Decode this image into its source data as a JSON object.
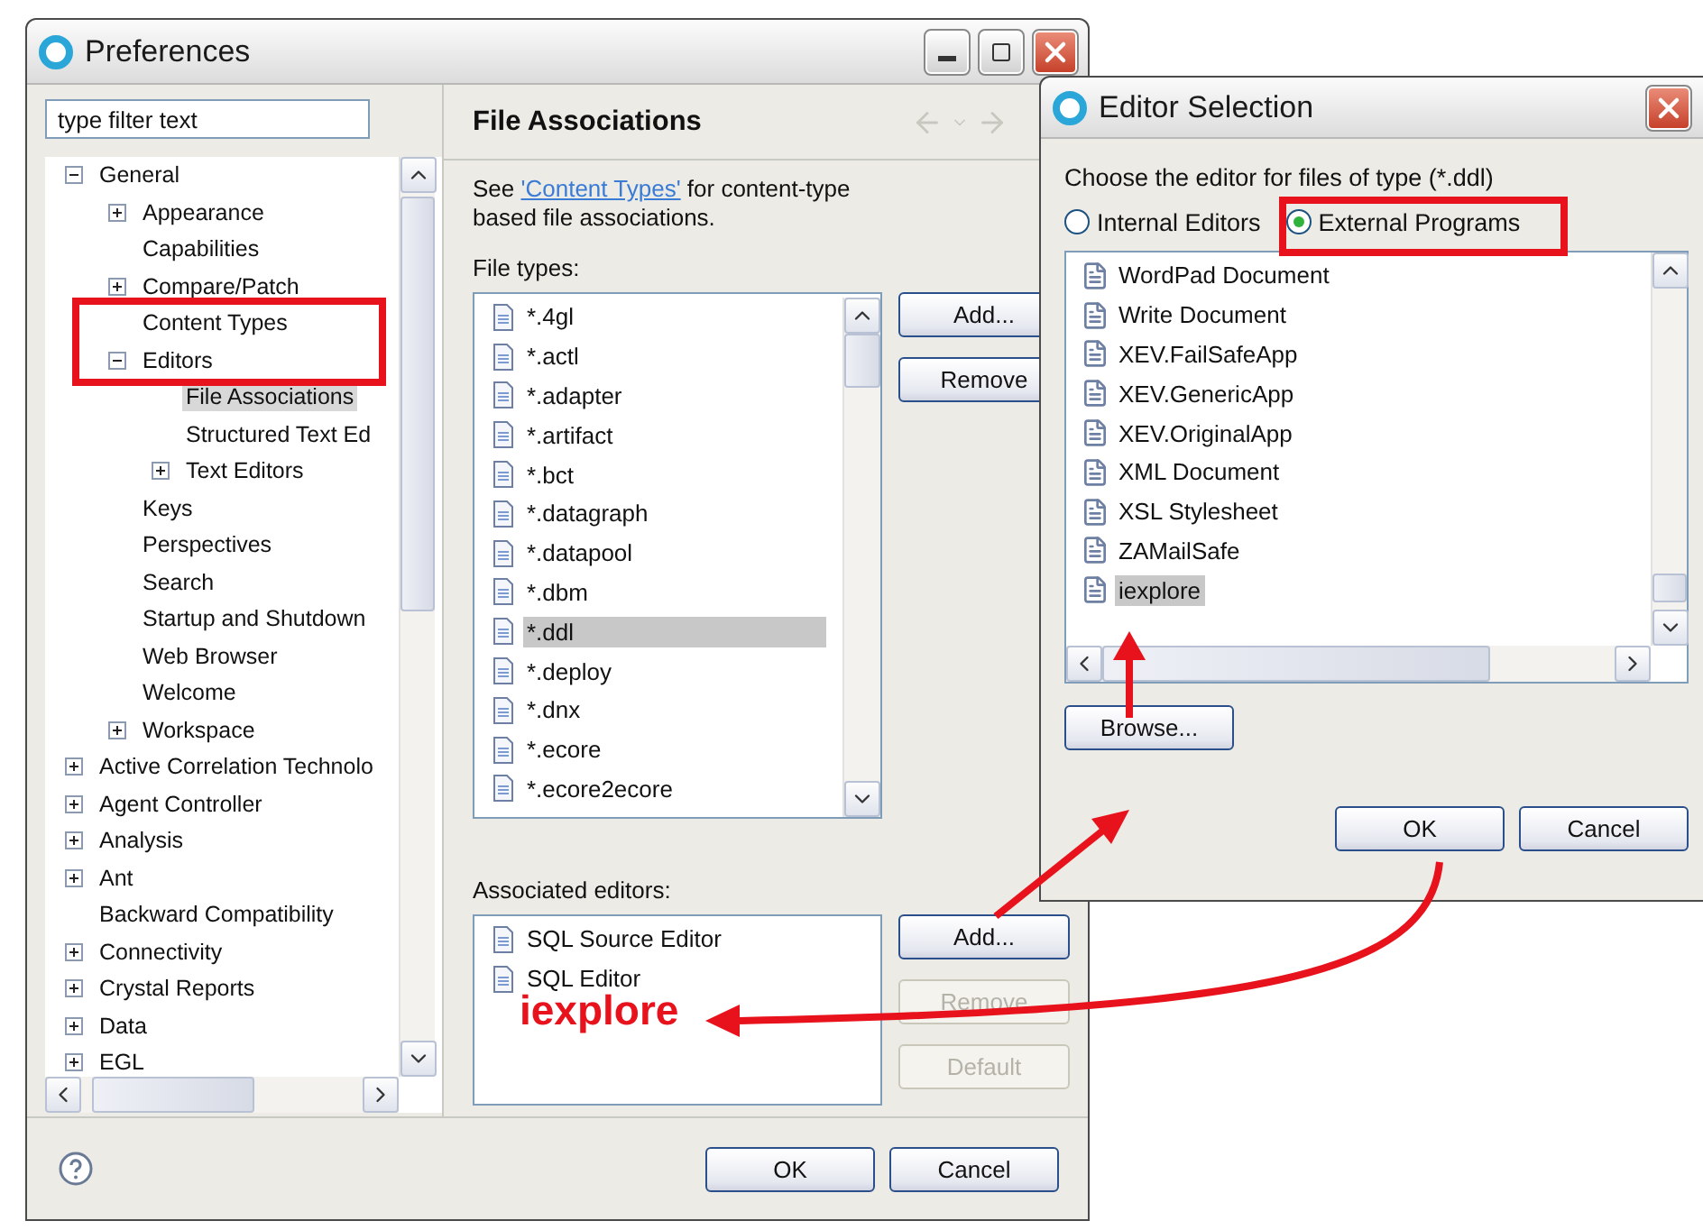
{
  "preferences": {
    "title": "Preferences",
    "filter": {
      "placeholder": "type filter text"
    },
    "tree": [
      {
        "label": "General",
        "expanded": true,
        "selected": false,
        "children": [
          {
            "label": "Appearance",
            "expanded": false,
            "selected": false
          },
          {
            "label": "Capabilities",
            "selected": false
          },
          {
            "label": "Compare/Patch",
            "expanded": false,
            "selected": false
          },
          {
            "label": "Content Types",
            "selected": false
          },
          {
            "label": "Editors",
            "expanded": true,
            "selected": false,
            "children": [
              {
                "label": "File Associations",
                "selected": true
              },
              {
                "label": "Structured Text Ed",
                "selected": false
              },
              {
                "label": "Text Editors",
                "expanded": false,
                "selected": false
              }
            ]
          },
          {
            "label": "Keys",
            "selected": false
          },
          {
            "label": "Perspectives",
            "selected": false
          },
          {
            "label": "Search",
            "selected": false
          },
          {
            "label": "Startup and Shutdown",
            "selected": false
          },
          {
            "label": "Web Browser",
            "selected": false
          },
          {
            "label": "Welcome",
            "selected": false
          },
          {
            "label": "Workspace",
            "expanded": false,
            "selected": false
          }
        ]
      },
      {
        "label": "Active Correlation Technolo",
        "expanded": false,
        "selected": false
      },
      {
        "label": "Agent Controller",
        "expanded": false,
        "selected": false
      },
      {
        "label": "Analysis",
        "expanded": false,
        "selected": false
      },
      {
        "label": "Ant",
        "expanded": false,
        "selected": false
      },
      {
        "label": "Backward Compatibility",
        "selected": false
      },
      {
        "label": "Connectivity",
        "expanded": false,
        "selected": false
      },
      {
        "label": "Crystal Reports",
        "expanded": false,
        "selected": false
      },
      {
        "label": "Data",
        "expanded": false,
        "selected": false
      },
      {
        "label": "EGL",
        "expanded": false,
        "selected": false
      }
    ],
    "page": {
      "title": "File Associations",
      "intro": {
        "before": "See ",
        "link": "'Content Types'",
        "after": " for content-type based file associations."
      },
      "file_types": {
        "label": "File types:",
        "items": [
          {
            "name": "*.4gl",
            "selected": false
          },
          {
            "name": "*.actl",
            "selected": false
          },
          {
            "name": "*.adapter",
            "selected": false
          },
          {
            "name": "*.artifact",
            "selected": false
          },
          {
            "name": "*.bct",
            "selected": false
          },
          {
            "name": "*.datagraph",
            "selected": false
          },
          {
            "name": "*.datapool",
            "selected": false
          },
          {
            "name": "*.dbm",
            "selected": false
          },
          {
            "name": "*.ddl",
            "selected": true
          },
          {
            "name": "*.deploy",
            "selected": false
          },
          {
            "name": "*.dnx",
            "selected": false
          },
          {
            "name": "*.ecore",
            "selected": false
          },
          {
            "name": "*.ecore2ecore",
            "selected": false
          }
        ],
        "buttons": [
          {
            "label": "Add...",
            "disabled": false
          },
          {
            "label": "Remove",
            "disabled": false
          }
        ]
      },
      "associated_editors": {
        "label": "Associated editors:",
        "items": [
          {
            "name": "SQL Source Editor",
            "selected": false
          },
          {
            "name": "SQL Editor",
            "selected": false
          }
        ],
        "buttons": [
          {
            "label": "Add...",
            "disabled": false
          },
          {
            "label": "Remove",
            "disabled": true
          },
          {
            "label": "Default",
            "disabled": true
          }
        ]
      }
    },
    "buttons": [
      "OK",
      "Cancel"
    ]
  },
  "editor_selection": {
    "title": "Editor Selection",
    "prompt": "Choose the editor for files of type (*.ddl)",
    "options": [
      {
        "label": "Internal Editors",
        "selected": false
      },
      {
        "label": "External Programs",
        "selected": true
      }
    ],
    "programs": [
      {
        "name": "WordPad Document",
        "selected": false
      },
      {
        "name": "Write Document",
        "selected": false
      },
      {
        "name": "XEV.FailSafeApp",
        "selected": false
      },
      {
        "name": "XEV.GenericApp",
        "selected": false
      },
      {
        "name": "XEV.OriginalApp",
        "selected": false
      },
      {
        "name": "XML Document",
        "selected": false
      },
      {
        "name": "XSL Stylesheet",
        "selected": false
      },
      {
        "name": "ZAMailSafe",
        "selected": false
      },
      {
        "name": "iexplore",
        "selected": true
      }
    ],
    "browse": "Browse...",
    "buttons": [
      "OK",
      "Cancel"
    ]
  },
  "annotation": {
    "note": "iexplore"
  }
}
